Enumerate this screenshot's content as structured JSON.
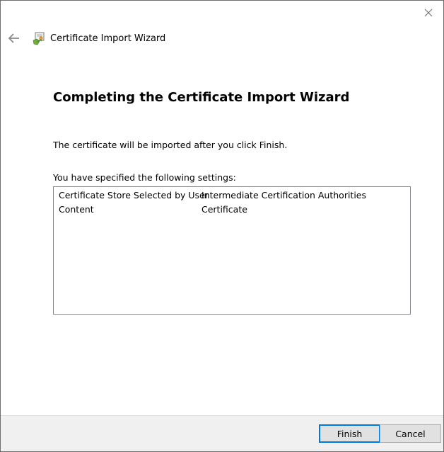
{
  "window": {
    "title": "Certificate Import Wizard",
    "close_icon": "close-icon",
    "back_icon": "back-arrow-icon",
    "app_icon": "certificate-icon"
  },
  "content": {
    "heading": "Completing the Certificate Import Wizard",
    "info": "The certificate will be imported after you click Finish.",
    "settings_label": "You have specified the following settings:",
    "settings": [
      {
        "key": "Certificate Store Selected by User",
        "value": "Intermediate Certification Authorities"
      },
      {
        "key": "Content",
        "value": "Certificate"
      }
    ]
  },
  "footer": {
    "finish_label": "Finish",
    "cancel_label": "Cancel"
  },
  "colors": {
    "accent": "#0078d7",
    "footer_bg": "#f0f0f0"
  }
}
